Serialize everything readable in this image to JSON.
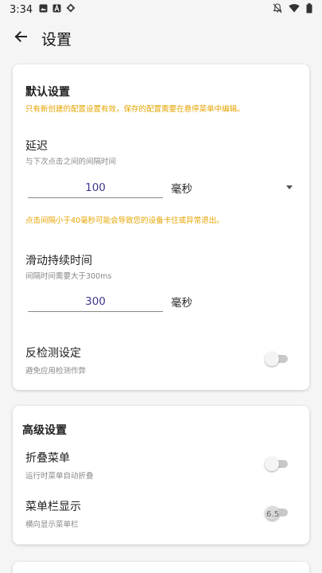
{
  "status_bar": {
    "time": "3:34",
    "left_icons": [
      "image-icon",
      "font-icon",
      "diamond-icon"
    ],
    "right_icons": [
      "notifications-off-icon",
      "wifi-icon",
      "battery-icon"
    ]
  },
  "header": {
    "title": "设置",
    "back_icon": "arrow-left-icon"
  },
  "default_settings": {
    "title": "默认设置",
    "note": "只有新创建的配置设置有效，保存的配置需要在悬停菜单中编辑。",
    "delay": {
      "label": "延迟",
      "description": "与下次点击之间的间隔时间",
      "value": "100",
      "unit": "毫秒",
      "warning": "点击间隔小于40毫秒可能会导致您的设备卡住或异常退出。"
    },
    "swipe_duration": {
      "label": "滑动持续时间",
      "description": "间隔时间需要大于300ms",
      "value": "300",
      "unit": "毫秒"
    },
    "anti_detection": {
      "label": "反检测设定",
      "description": "避免应用检测作弊",
      "enabled": false
    }
  },
  "advanced_settings": {
    "title": "高级设置",
    "collapse_menu": {
      "label": "折叠菜单",
      "description": "运行时菜单自动折叠",
      "enabled": false
    },
    "menu_bar_display": {
      "label": "菜单栏显示",
      "description": "横向显示菜单栏",
      "enabled": false
    }
  },
  "floating_badge": "6.5",
  "colors": {
    "accent_text": "#3d3a8f",
    "warning": "#e6a400",
    "background": "#f5f5f5"
  }
}
